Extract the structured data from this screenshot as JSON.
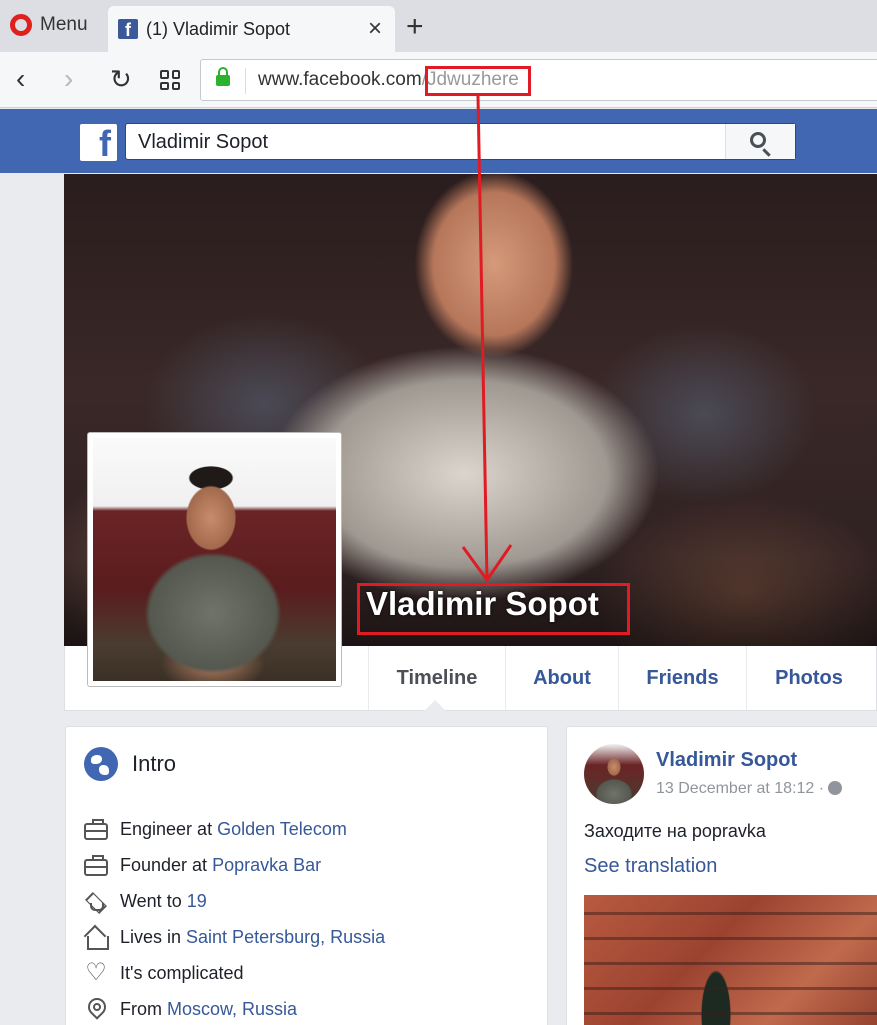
{
  "browser": {
    "menu_label": "Menu",
    "tab_title": "(1) Vladimir Sopot",
    "tab_close": "×",
    "new_tab": "+",
    "url_domain": "www.facebook.com",
    "url_path": "/Jdwuzhere"
  },
  "facebook": {
    "logo_letter": "f",
    "search_value": "Vladimir Sopot"
  },
  "profile": {
    "name": "Vladimir Sopot",
    "nav": [
      {
        "label": "Timeline"
      },
      {
        "label": "About"
      },
      {
        "label": "Friends"
      },
      {
        "label": "Photos"
      }
    ]
  },
  "intro": {
    "title": "Intro",
    "rows": [
      {
        "icon": "briefcase-icon",
        "text": "Engineer at",
        "link": "Golden Telecom"
      },
      {
        "icon": "briefcase-icon",
        "text": "Founder at",
        "link": "Popravka Bar"
      },
      {
        "icon": "graduation-cap-icon",
        "text": "Went to",
        "link": "19"
      },
      {
        "icon": "house-icon",
        "text": "Lives in",
        "link": "Saint Petersburg, Russia"
      },
      {
        "icon": "heart-icon",
        "text": "It's complicated",
        "link": ""
      },
      {
        "icon": "location-pin-icon",
        "text": "From",
        "link": "Moscow, Russia"
      }
    ]
  },
  "post": {
    "author": "Vladimir Sopot",
    "time": "13 December at 18:12 ·",
    "text": "Заходите на popravka",
    "translate": "See translation"
  },
  "annotation_color": "#e01b24",
  "brand_color": "#4267b2"
}
